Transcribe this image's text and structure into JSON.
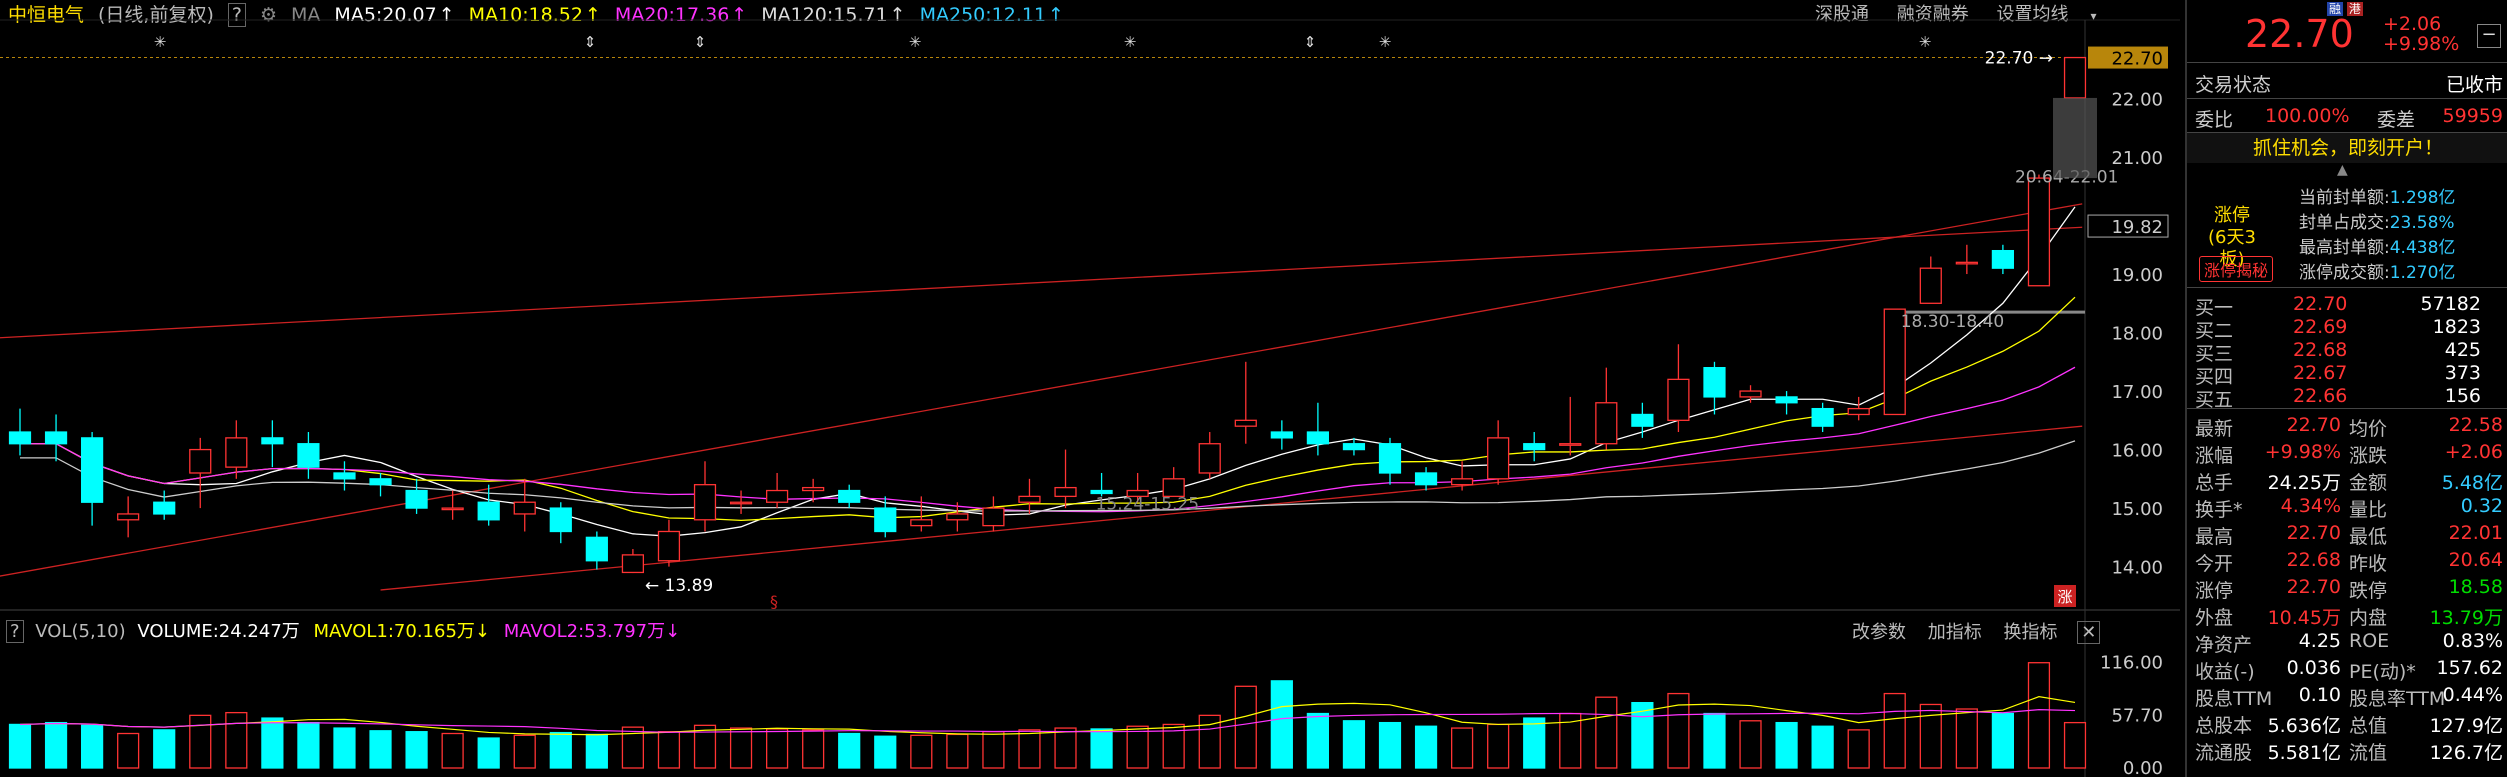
{
  "header": {
    "stock_name": "中恒电气",
    "period_label": "(日线,前复权)",
    "help_icon": "?",
    "ma_label": "MA",
    "ma5": "MA5:20.07",
    "ma10": "MA10:18.52",
    "ma20": "MA20:17.36",
    "ma120": "MA120:15.71",
    "ma250": "MA250:12.11",
    "arrow": "↑"
  },
  "top_tools": [
    "深股通",
    "融资融券",
    "设置均线"
  ],
  "vol_header": {
    "help_icon": "?",
    "vol_label": "VOL(5,10)",
    "volume": "VOLUME:24.247万",
    "mavol1": "MAVOL1:70.165万",
    "mavol2": "MAVOL2:53.797万",
    "arrow": "↓"
  },
  "vol_tools": [
    "改参数",
    "加指标",
    "换指标"
  ],
  "price_axis": [
    "22.70",
    "22.00",
    "21.00",
    "19.82",
    "19.00",
    "18.00",
    "17.00",
    "16.00",
    "15.00",
    "14.00"
  ],
  "vol_axis": [
    "116.00",
    "57.70",
    "0.00"
  ],
  "annotations": {
    "high_label": "22.70",
    "low_label": "13.89",
    "range1": "20.64-22.01",
    "range2": "18.30-18.40",
    "range3": "15.24-15.25",
    "limit_tag": "涨"
  },
  "chart_data": {
    "type": "candlestick",
    "title": "中恒电气 (日线,前复权)",
    "ylim": [
      13.6,
      23.0
    ],
    "candles": [
      {
        "o": 16.3,
        "c": 16.1,
        "h": 16.7,
        "l": 15.9
      },
      {
        "o": 16.3,
        "c": 16.1,
        "h": 16.6,
        "l": 15.8
      },
      {
        "o": 16.2,
        "c": 15.1,
        "h": 16.3,
        "l": 14.7
      },
      {
        "o": 14.8,
        "c": 14.9,
        "h": 15.2,
        "l": 14.5
      },
      {
        "o": 15.1,
        "c": 14.9,
        "h": 15.3,
        "l": 14.8
      },
      {
        "o": 15.6,
        "c": 16.0,
        "h": 16.2,
        "l": 15.0
      },
      {
        "o": 15.7,
        "c": 16.2,
        "h": 16.5,
        "l": 15.5
      },
      {
        "o": 16.2,
        "c": 16.1,
        "h": 16.5,
        "l": 15.7
      },
      {
        "o": 16.1,
        "c": 15.7,
        "h": 16.3,
        "l": 15.5
      },
      {
        "o": 15.6,
        "c": 15.5,
        "h": 15.8,
        "l": 15.3
      },
      {
        "o": 15.5,
        "c": 15.4,
        "h": 15.6,
        "l": 15.2
      },
      {
        "o": 15.3,
        "c": 15.0,
        "h": 15.5,
        "l": 14.9
      },
      {
        "o": 15.0,
        "c": 15.0,
        "h": 15.3,
        "l": 14.8
      },
      {
        "o": 15.1,
        "c": 14.8,
        "h": 15.4,
        "l": 14.7
      },
      {
        "o": 14.9,
        "c": 15.1,
        "h": 15.5,
        "l": 14.6
      },
      {
        "o": 15.0,
        "c": 14.6,
        "h": 15.1,
        "l": 14.4
      },
      {
        "o": 14.5,
        "c": 14.1,
        "h": 14.6,
        "l": 13.95
      },
      {
        "o": 13.9,
        "c": 14.2,
        "h": 14.3,
        "l": 13.89
      },
      {
        "o": 14.1,
        "c": 14.6,
        "h": 14.8,
        "l": 14.0
      },
      {
        "o": 14.8,
        "c": 15.4,
        "h": 15.8,
        "l": 14.6
      },
      {
        "o": 15.1,
        "c": 15.1,
        "h": 15.3,
        "l": 14.9
      },
      {
        "o": 15.1,
        "c": 15.3,
        "h": 15.6,
        "l": 15.0
      },
      {
        "o": 15.3,
        "c": 15.35,
        "h": 15.5,
        "l": 15.1
      },
      {
        "o": 15.3,
        "c": 15.1,
        "h": 15.4,
        "l": 15.0
      },
      {
        "o": 15.0,
        "c": 14.6,
        "h": 15.2,
        "l": 14.5
      },
      {
        "o": 14.7,
        "c": 14.8,
        "h": 15.2,
        "l": 14.6
      },
      {
        "o": 14.8,
        "c": 14.9,
        "h": 15.1,
        "l": 14.6
      },
      {
        "o": 14.7,
        "c": 15.0,
        "h": 15.2,
        "l": 14.6
      },
      {
        "o": 15.1,
        "c": 15.2,
        "h": 15.5,
        "l": 14.9
      },
      {
        "o": 15.2,
        "c": 15.35,
        "h": 16.0,
        "l": 15.0
      },
      {
        "o": 15.3,
        "c": 15.25,
        "h": 15.6,
        "l": 15.2
      },
      {
        "o": 15.2,
        "c": 15.3,
        "h": 15.6,
        "l": 15.1
      },
      {
        "o": 15.2,
        "c": 15.5,
        "h": 15.7,
        "l": 15.2
      },
      {
        "o": 15.6,
        "c": 16.1,
        "h": 16.3,
        "l": 15.5
      },
      {
        "o": 16.4,
        "c": 16.5,
        "h": 17.5,
        "l": 16.1
      },
      {
        "o": 16.3,
        "c": 16.2,
        "h": 16.5,
        "l": 16.0
      },
      {
        "o": 16.3,
        "c": 16.1,
        "h": 16.8,
        "l": 15.9
      },
      {
        "o": 16.1,
        "c": 16.0,
        "h": 16.2,
        "l": 15.9
      },
      {
        "o": 16.1,
        "c": 15.6,
        "h": 16.2,
        "l": 15.4
      },
      {
        "o": 15.6,
        "c": 15.4,
        "h": 15.7,
        "l": 15.3
      },
      {
        "o": 15.4,
        "c": 15.5,
        "h": 15.8,
        "l": 15.3
      },
      {
        "o": 15.5,
        "c": 16.2,
        "h": 16.5,
        "l": 15.4
      },
      {
        "o": 16.1,
        "c": 16.0,
        "h": 16.3,
        "l": 15.8
      },
      {
        "o": 16.1,
        "c": 16.1,
        "h": 16.9,
        "l": 15.9
      },
      {
        "o": 16.1,
        "c": 16.8,
        "h": 17.4,
        "l": 16.0
      },
      {
        "o": 16.6,
        "c": 16.4,
        "h": 16.8,
        "l": 16.2
      },
      {
        "o": 16.5,
        "c": 17.2,
        "h": 17.8,
        "l": 16.3
      },
      {
        "o": 17.4,
        "c": 16.9,
        "h": 17.5,
        "l": 16.6
      },
      {
        "o": 16.9,
        "c": 17.0,
        "h": 17.1,
        "l": 16.8
      },
      {
        "o": 16.9,
        "c": 16.8,
        "h": 17.0,
        "l": 16.6
      },
      {
        "o": 16.7,
        "c": 16.4,
        "h": 16.8,
        "l": 16.3
      },
      {
        "o": 16.6,
        "c": 16.7,
        "h": 16.9,
        "l": 16.5
      },
      {
        "o": 16.6,
        "c": 18.4,
        "h": 18.4,
        "l": 16.6
      },
      {
        "o": 18.5,
        "c": 19.1,
        "h": 19.3,
        "l": 18.5
      },
      {
        "o": 19.2,
        "c": 19.2,
        "h": 19.5,
        "l": 19.0
      },
      {
        "o": 19.4,
        "c": 19.1,
        "h": 19.5,
        "l": 19.0
      },
      {
        "o": 18.8,
        "c": 20.64,
        "h": 20.7,
        "l": 18.8
      },
      {
        "o": 22.01,
        "c": 22.7,
        "h": 22.7,
        "l": 22.01
      }
    ],
    "volumes": [
      48,
      50,
      47,
      38,
      42,
      58,
      61,
      55,
      50,
      44,
      41,
      40,
      38,
      33,
      36,
      39,
      37,
      45,
      40,
      47,
      44,
      43,
      42,
      38,
      35,
      36,
      37,
      40,
      42,
      44,
      43,
      46,
      48,
      58,
      90,
      96,
      60,
      52,
      50,
      46,
      44,
      48,
      55,
      60,
      78,
      72,
      82,
      60,
      52,
      50,
      46,
      42,
      82,
      70,
      65,
      60,
      116,
      50
    ],
    "vol_ylim": [
      0,
      130
    ]
  },
  "panel": {
    "tags": [
      "融",
      "港"
    ],
    "price": "22.70",
    "change": "+2.06",
    "change_pct": "+9.98%",
    "minus_icon": "−",
    "status_label": "交易状态",
    "status_value": "已收市",
    "weibi_label": "委比",
    "weibi_value": "100.00%",
    "weicha_label": "委差",
    "weicha_value": "59959",
    "promo": "抓住机会，即刻开户！",
    "limit_title": "涨停",
    "limit_sub": "(6天3板)",
    "limit_btn": "涨停揭秘",
    "limit_stats": [
      {
        "label": "当前封单额:",
        "value": "1.298亿"
      },
      {
        "label": "封单占成交:",
        "value": "23.58%"
      },
      {
        "label": "最高封单额:",
        "value": "4.438亿"
      },
      {
        "label": "涨停成交额:",
        "value": "1.270亿"
      }
    ],
    "bids": [
      {
        "label": "买一",
        "price": "22.70",
        "vol": "57182"
      },
      {
        "label": "买二",
        "price": "22.69",
        "vol": "1823"
      },
      {
        "label": "买三",
        "price": "22.68",
        "vol": "425"
      },
      {
        "label": "买四",
        "price": "22.67",
        "vol": "373"
      },
      {
        "label": "买五",
        "price": "22.66",
        "vol": "156"
      }
    ],
    "stats": [
      [
        "最新",
        "22.70",
        "均价",
        "22.58"
      ],
      [
        "涨幅",
        "+9.98%",
        "涨跌",
        "+2.06"
      ],
      [
        "总手",
        "24.25万",
        "金额",
        "5.48亿"
      ],
      [
        "换手*",
        "4.34%",
        "量比",
        "0.32"
      ],
      [
        "最高",
        "22.70",
        "最低",
        "22.01"
      ],
      [
        "今开",
        "22.68",
        "昨收",
        "20.64"
      ],
      [
        "涨停",
        "22.70",
        "跌停",
        "18.58"
      ],
      [
        "外盘",
        "10.45万",
        "内盘",
        "13.79万"
      ],
      [
        "净资产",
        "4.25",
        "ROE",
        "0.83%"
      ],
      [
        "收益(-)",
        "0.036",
        "PE(动)*",
        "157.62"
      ],
      [
        "股息TTM",
        "0.10",
        "股息率TTM",
        "0.44%"
      ],
      [
        "总股本",
        "5.636亿",
        "总值",
        "127.9亿"
      ],
      [
        "流通股",
        "5.581亿",
        "流值",
        "126.7亿"
      ]
    ],
    "colors": {
      "up": "#ff3333",
      "down": "#00ffff",
      "yellow": "#ffff00",
      "green": "#00dd00"
    }
  }
}
